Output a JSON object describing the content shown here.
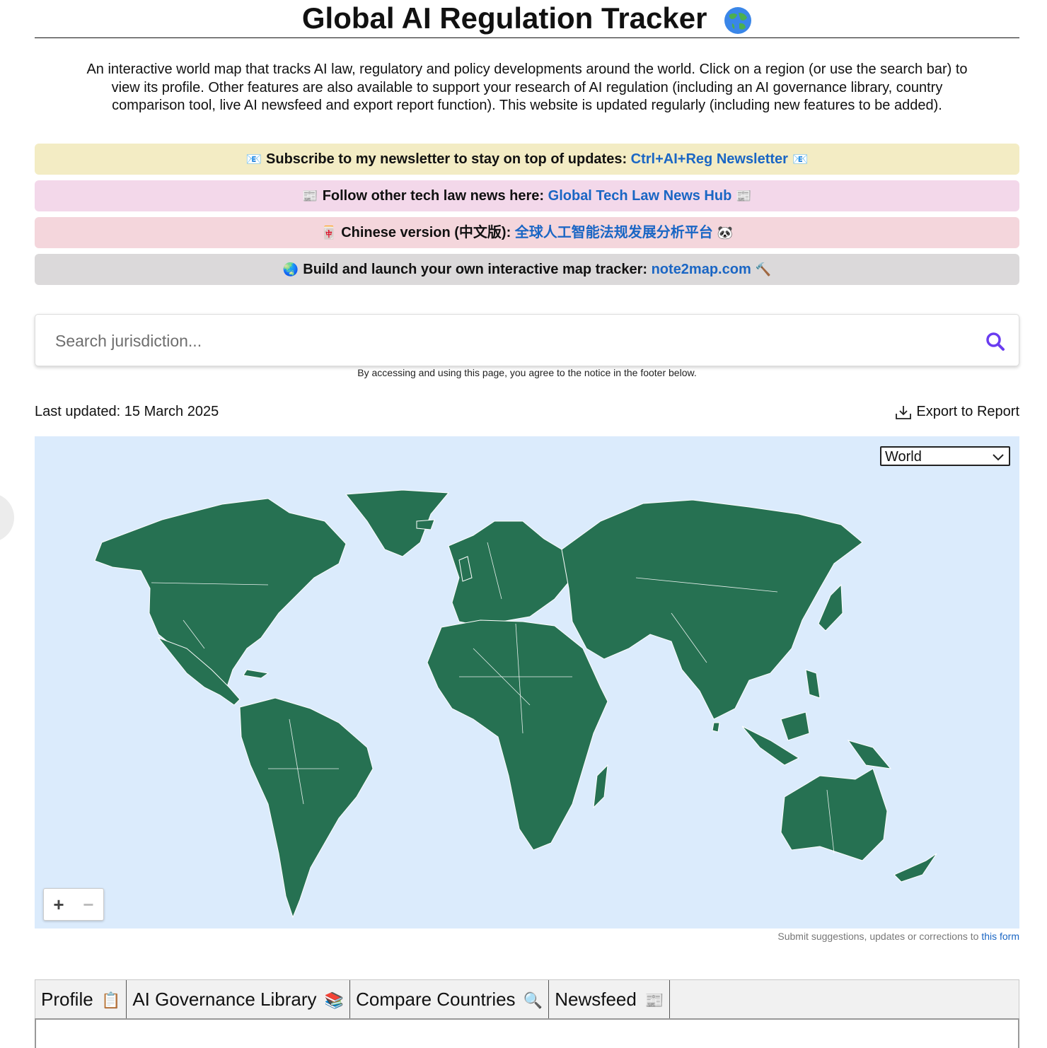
{
  "header": {
    "title": "Global AI Regulation Tracker",
    "intro": "An interactive world map that tracks AI law, regulatory and policy developments around the world. Click on a region (or use the search bar) to view its profile. Other features are also available to support your research of AI regulation (including an AI governance library, country comparison tool, live AI newsfeed and export report function). This website is updated regularly (including new features to be added)."
  },
  "banners": [
    {
      "emoji": "📧",
      "text": "Subscribe to my newsletter to stay on top of updates:",
      "link": "Ctrl+AI+Reg Newsletter",
      "emoji_end": "📧",
      "color": "#f3ecc4"
    },
    {
      "emoji": "📰",
      "text": "Follow other tech law news here:",
      "link": "Global Tech Law News Hub",
      "emoji_end": "📰",
      "color": "#f3d8ea"
    },
    {
      "emoji": "🀄",
      "text": "Chinese version (中文版):",
      "link": "全球人工智能法规发展分析平台",
      "emoji_end": "🐼",
      "color": "#f4d6dc"
    },
    {
      "emoji": "🌏",
      "text": "Build and launch your own interactive map tracker:",
      "link": "note2map.com",
      "emoji_end": "🔨",
      "color": "#dbd9da"
    }
  ],
  "search": {
    "placeholder": "Search jurisdiction...",
    "notice": "By accessing and using this page, you agree to the notice in the footer below."
  },
  "meta": {
    "last_updated": "Last updated: 15 March 2025",
    "export_label": "Export to Report"
  },
  "map": {
    "region_selected": "World",
    "zoom_in": "+",
    "zoom_out": "−",
    "land_color": "#267152",
    "ocean_color": "#dbebfc"
  },
  "suggest": {
    "text": "Submit suggestions, updates or corrections to",
    "link": "this form"
  },
  "tabs": [
    {
      "label": "Profile",
      "emoji": "📋"
    },
    {
      "label": "AI Governance Library",
      "emoji": "📚"
    },
    {
      "label": "Compare Countries",
      "emoji": "🔍"
    },
    {
      "label": "Newsfeed",
      "emoji": "📰"
    }
  ],
  "colors": {
    "link": "#1a66c4",
    "search_icon": "#6a3cf0"
  }
}
